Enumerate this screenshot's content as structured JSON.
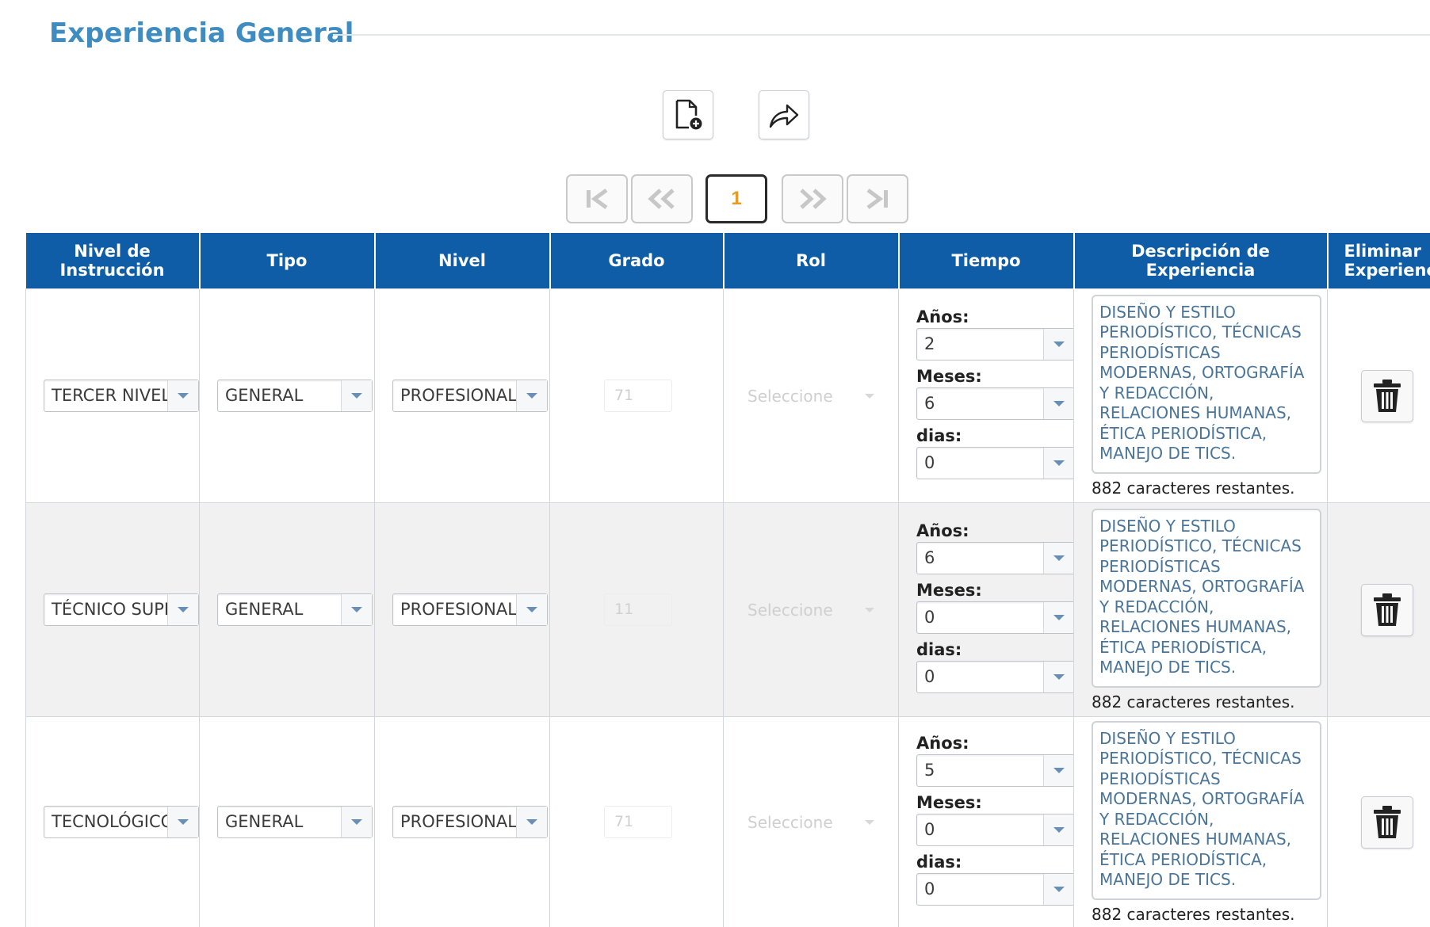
{
  "section": {
    "title": "Experiencia General"
  },
  "toolbar": {
    "icons": [
      "new-document-icon",
      "forward-share-icon"
    ]
  },
  "pager": {
    "current_page": "1",
    "icons": [
      "first-page-icon",
      "previous-page-icon",
      "next-page-icon",
      "last-page-icon"
    ]
  },
  "table": {
    "headers": {
      "nivel_instruccion": "Nivel de\nInstrucción",
      "tipo": "Tipo",
      "nivel": "Nivel",
      "grado": "Grado",
      "rol": "Rol",
      "tiempo": "Tiempo",
      "descripcion": "Descripción de\nExperiencia",
      "eliminar": "Eliminar\nExperiencia"
    },
    "time_labels": {
      "anios": "Años:",
      "meses": "Meses:",
      "dias": "dias:"
    },
    "rows": [
      {
        "nivel_instruccion": "TERCER NIVEL",
        "tipo": "GENERAL",
        "nivel": "PROFESIONAL",
        "grado": "71",
        "rol": "Seleccione",
        "anios": "2",
        "meses": "6",
        "dias": "0",
        "descripcion": "DISEÑO Y ESTILO PERIODÍSTICO, TÉCNICAS PERIODÍSTICAS MODERNAS, ORTOGRAFÍA Y REDACCIÓN, RELACIONES HUMANAS, ÉTICA PERIODÍSTICA, MANEJO DE TICS.",
        "caracteres": "882 caracteres restantes."
      },
      {
        "nivel_instruccion": "TÉCNICO SUPE",
        "tipo": "GENERAL",
        "nivel": "PROFESIONAL",
        "grado": "11",
        "rol": "Seleccione",
        "anios": "6",
        "meses": "0",
        "dias": "0",
        "descripcion": "DISEÑO Y ESTILO PERIODÍSTICO, TÉCNICAS PERIODÍSTICAS MODERNAS, ORTOGRAFÍA Y REDACCIÓN, RELACIONES HUMANAS, ÉTICA PERIODÍSTICA, MANEJO DE TICS.",
        "caracteres": "882 caracteres restantes."
      },
      {
        "nivel_instruccion": "TECNOLÓGICO",
        "tipo": "GENERAL",
        "nivel": "PROFESIONAL",
        "grado": "71",
        "rol": "Seleccione",
        "anios": "5",
        "meses": "0",
        "dias": "0",
        "descripcion": "DISEÑO Y ESTILO PERIODÍSTICO, TÉCNICAS PERIODÍSTICAS MODERNAS, ORTOGRAFÍA Y REDACCIÓN, RELACIONES HUMANAS, ÉTICA PERIODÍSTICA, MANEJO DE TICS.",
        "caracteres": "882 caracteres restantes."
      }
    ]
  },
  "colors": {
    "title": "#3f8dc0",
    "header_bg": "#0e5da6",
    "header_text": "#ffffff",
    "description_text": "#4a7599",
    "current_page_text": "#e49b27"
  }
}
